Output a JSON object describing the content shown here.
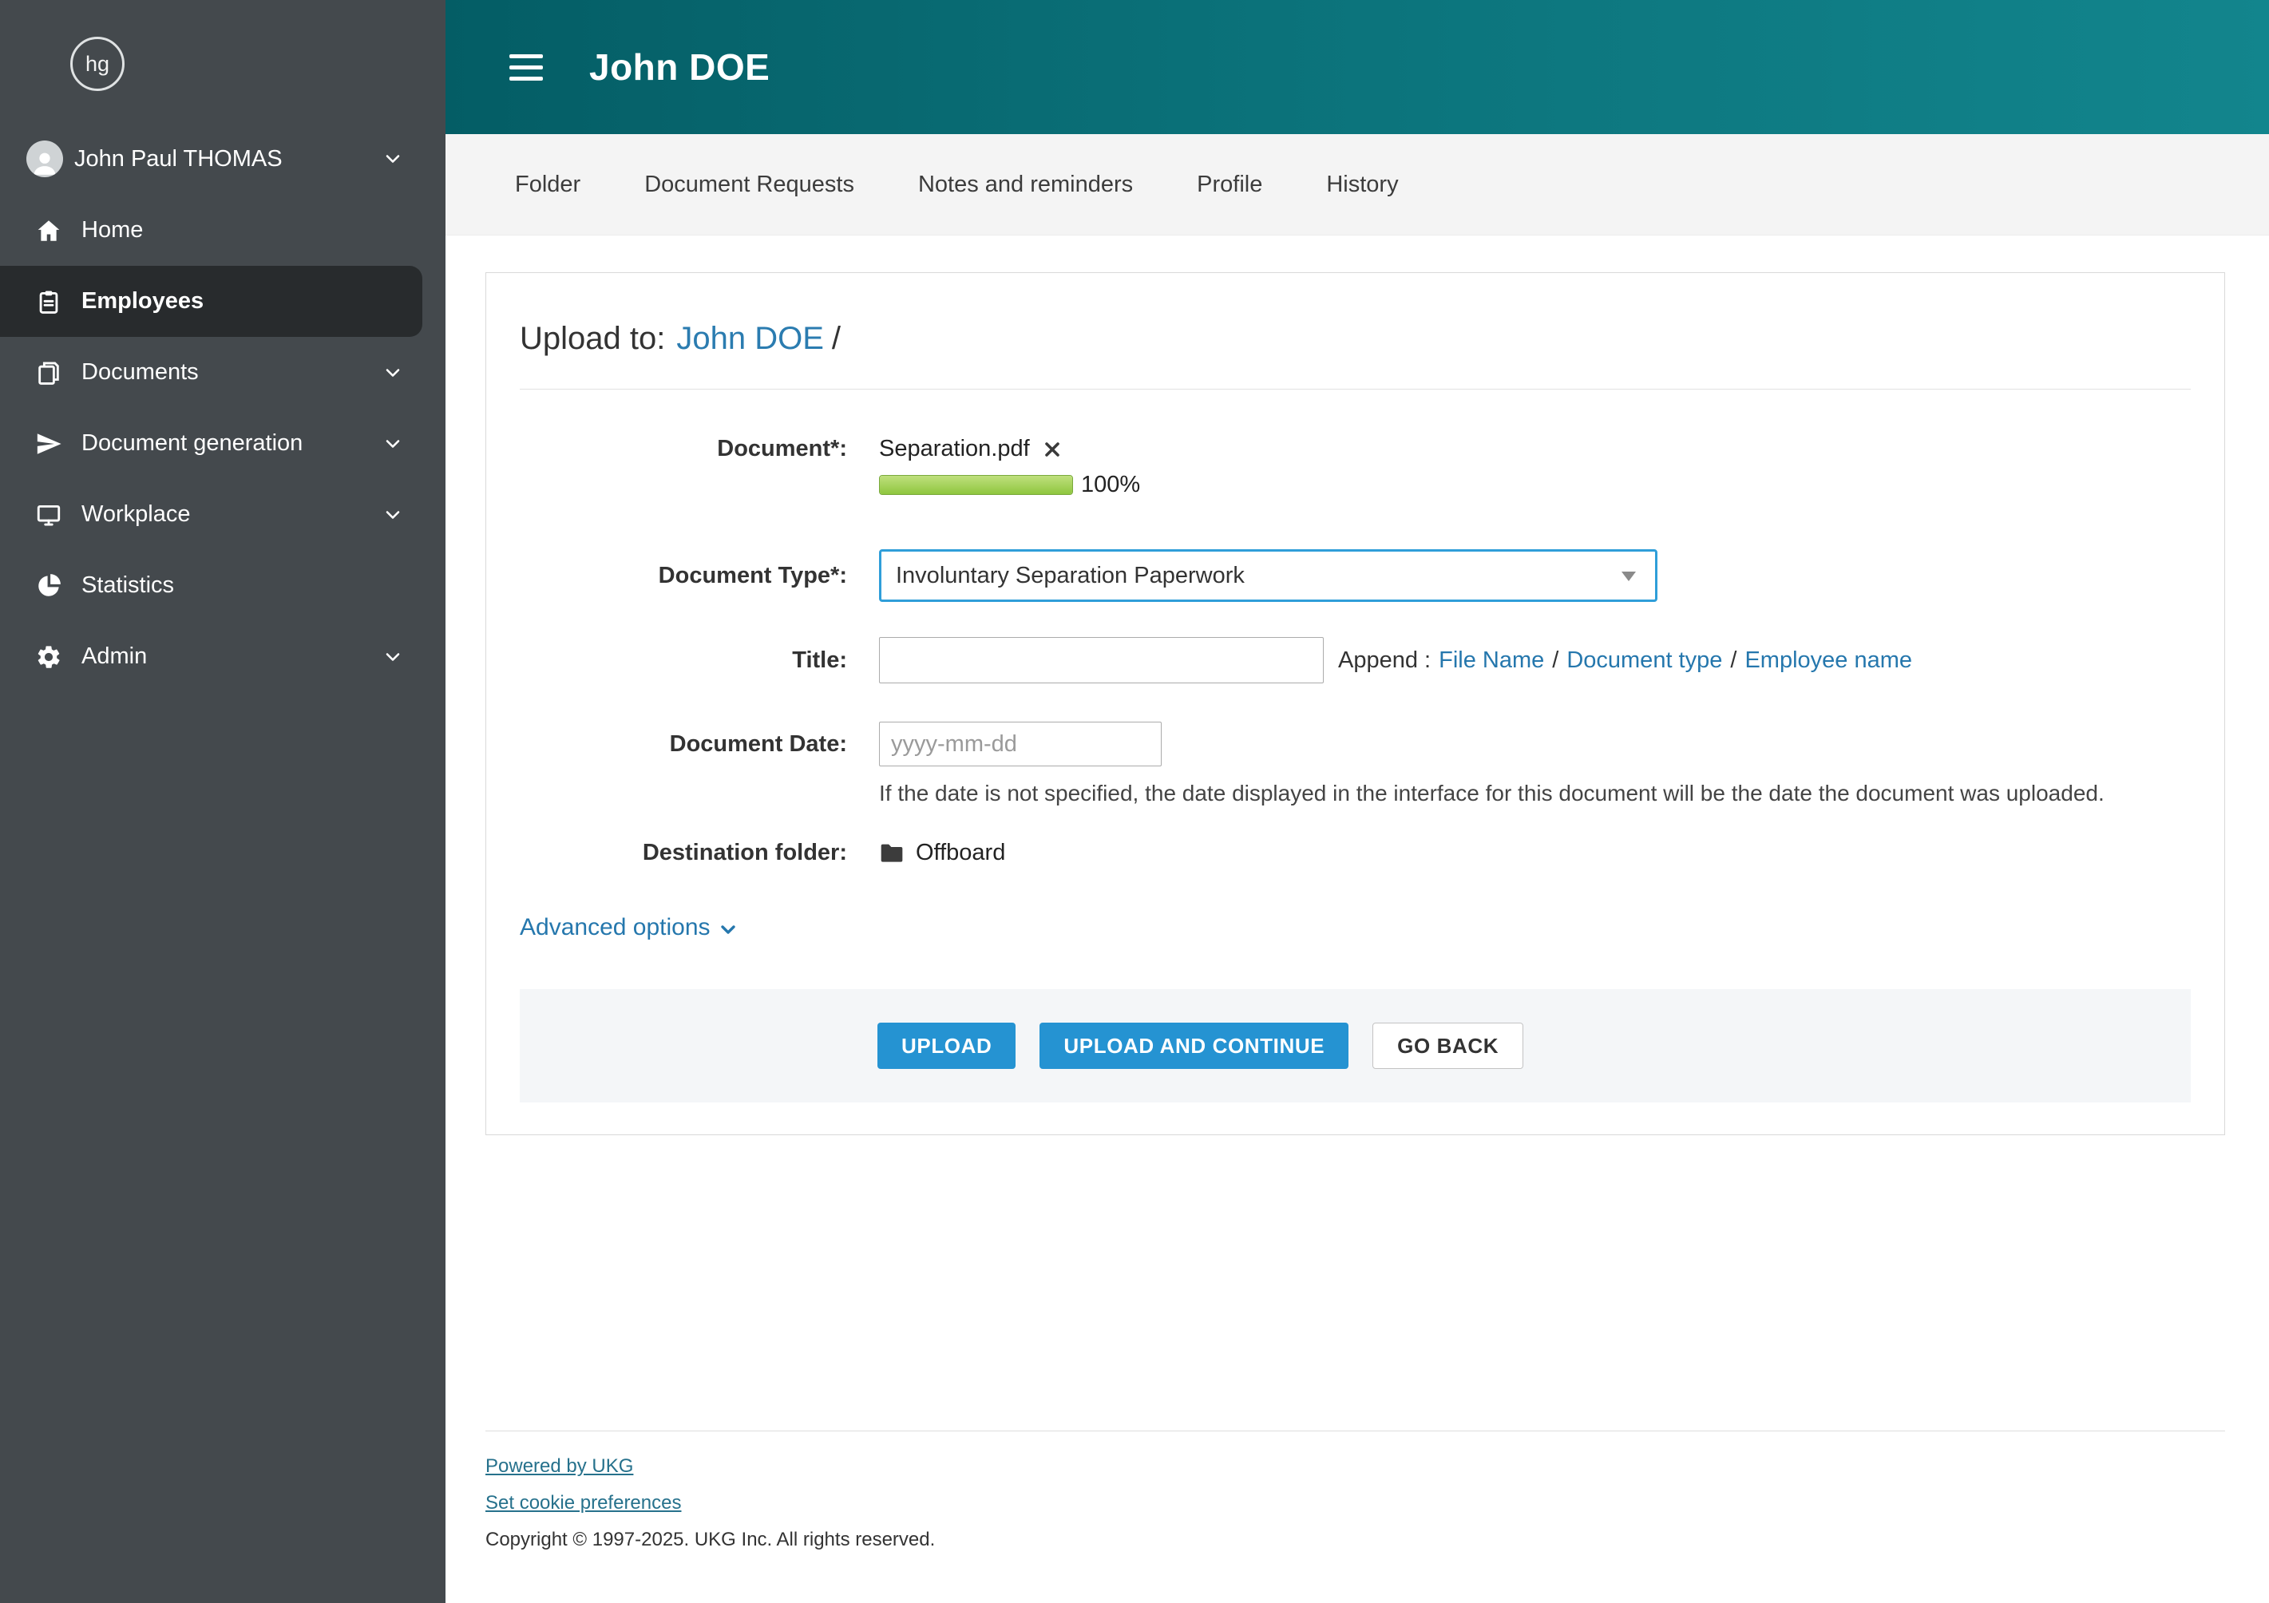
{
  "sidebar": {
    "logo": "hg",
    "user_name": "John Paul THOMAS",
    "items": [
      {
        "label": "Home"
      },
      {
        "label": "Employees"
      },
      {
        "label": "Documents"
      },
      {
        "label": "Document generation"
      },
      {
        "label": "Workplace"
      },
      {
        "label": "Statistics"
      },
      {
        "label": "Admin"
      }
    ]
  },
  "header": {
    "title": "John DOE"
  },
  "tabs": [
    {
      "label": "Folder"
    },
    {
      "label": "Document Requests"
    },
    {
      "label": "Notes and reminders"
    },
    {
      "label": "Profile"
    },
    {
      "label": "History"
    }
  ],
  "upload": {
    "heading_prefix": "Upload to:",
    "heading_link": "John DOE",
    "heading_suffix": "/",
    "document_label": "Document*:",
    "file_name": "Separation.pdf",
    "progress_percent": "100%",
    "document_type_label": "Document Type*:",
    "document_type_value": "Involuntary Separation Paperwork",
    "title_label": "Title:",
    "append_label": "Append :",
    "append_separator": "/",
    "append_links": [
      {
        "label": "File Name"
      },
      {
        "label": "Document type"
      },
      {
        "label": "Employee name"
      }
    ],
    "date_label": "Document Date:",
    "date_placeholder": "yyyy-mm-dd",
    "date_help": "If the date is not specified, the date displayed in the interface for this document will be the date the document was uploaded.",
    "folder_label": "Destination folder:",
    "folder_value": "Offboard",
    "advanced_options_label": "Advanced options",
    "buttons": {
      "upload": "UPLOAD",
      "upload_and_continue": "UPLOAD AND CONTINUE",
      "go_back": "GO BACK"
    }
  },
  "footer": {
    "powered_by": "Powered by UKG",
    "cookie_preferences": "Set cookie preferences",
    "copyright": "Copyright © 1997-2025. UKG Inc. All rights reserved."
  },
  "colors": {
    "accent_blue": "#2593d2",
    "link_blue": "#2577ad",
    "header_teal_start": "#045d65",
    "header_teal_end": "#12858d",
    "progress_green": "#8fc63f",
    "sidebar_bg": "#44494d",
    "sidebar_active_bg": "#282b2d"
  }
}
